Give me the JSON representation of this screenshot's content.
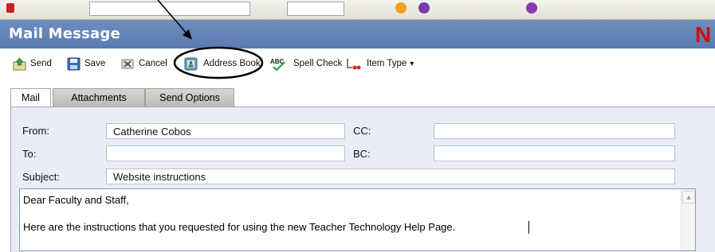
{
  "window": {
    "title": "Mail Message",
    "brand_letter": "N"
  },
  "toolbar": {
    "send_label": "Send",
    "save_label": "Save",
    "cancel_label": "Cancel",
    "address_book_label": "Address Book",
    "spell_check_label": "Spell Check",
    "item_type_label": "Item Type",
    "item_type_arrow": "▾"
  },
  "tabs": [
    {
      "label": "Mail",
      "active": true
    },
    {
      "label": "Attachments",
      "active": false
    },
    {
      "label": "Send Options",
      "active": false
    }
  ],
  "form": {
    "from_label": "From:",
    "from_value": "Catherine Cobos",
    "to_label": "To:",
    "to_value": "",
    "cc_label": "CC:",
    "cc_value": "",
    "bc_label": "BC:",
    "bc_value": "",
    "subject_label": "Subject:",
    "subject_value": "Website instructions"
  },
  "message": {
    "line1": "Dear Faculty and Staff,",
    "line2": "Here are the instructions that you requested for using the new Teacher Technology Help Page."
  },
  "colors": {
    "titlebar": "#5f80b4",
    "panel": "#e9eef6",
    "annotation": "#000000",
    "brand": "#cc1111"
  }
}
